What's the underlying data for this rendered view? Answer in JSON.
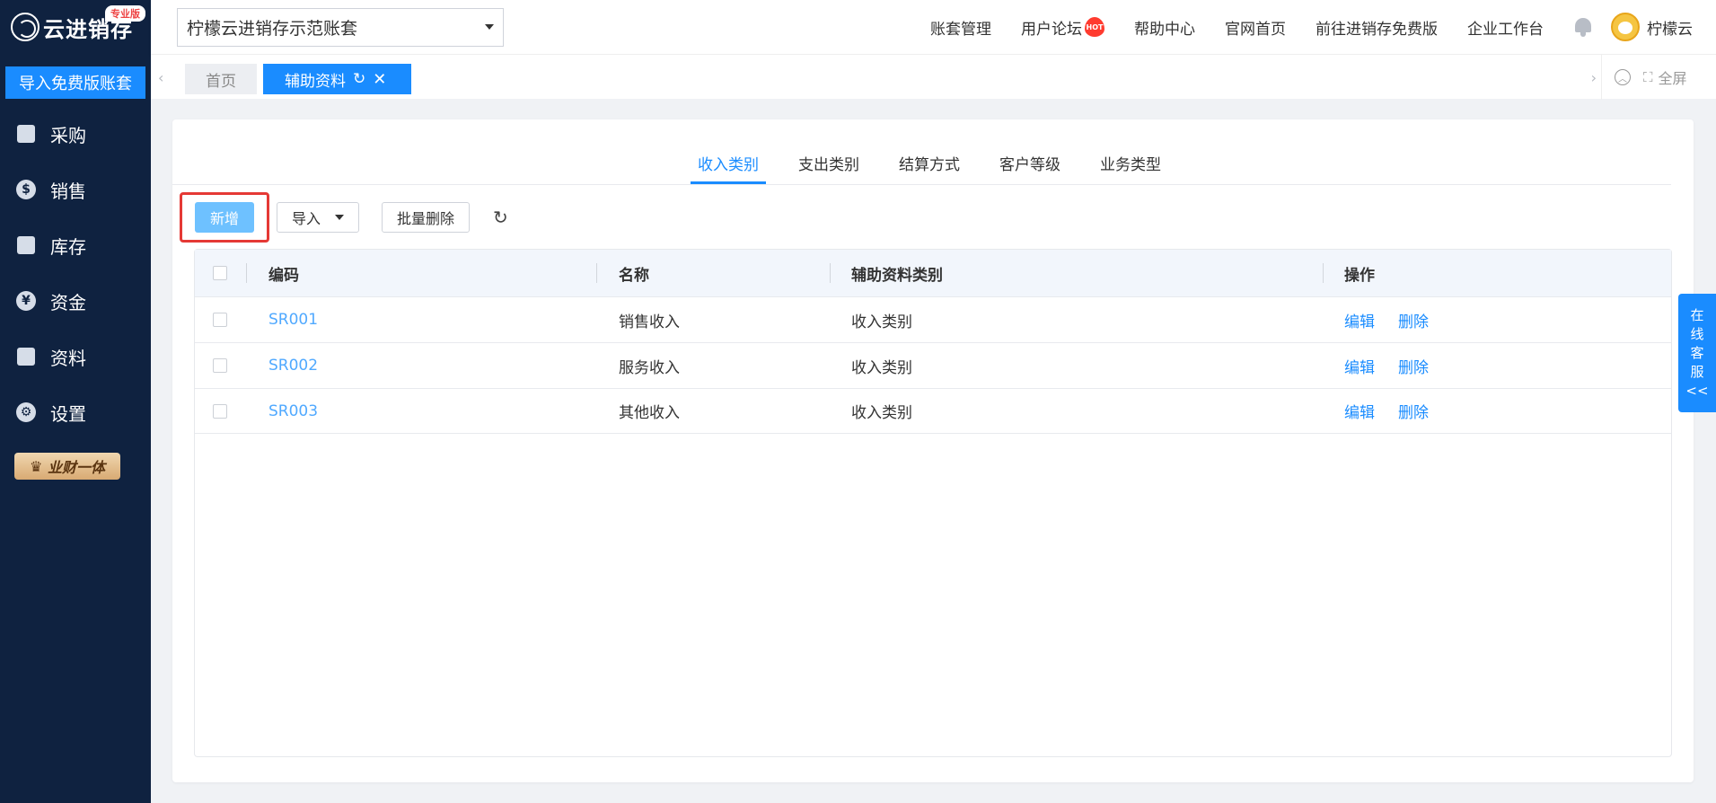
{
  "sidebar": {
    "logo_text": "云进销存",
    "pro_badge": "专业版",
    "import_button": "导入免费版账套",
    "items": [
      {
        "label": "采购",
        "icon": "shopping-bag-icon"
      },
      {
        "label": "销售",
        "icon": "sales-tag-icon"
      },
      {
        "label": "库存",
        "icon": "warehouse-icon"
      },
      {
        "label": "资金",
        "icon": "yen-coin-icon"
      },
      {
        "label": "资料",
        "icon": "document-icon"
      },
      {
        "label": "设置",
        "icon": "gear-icon"
      }
    ],
    "vip_badge": "业财一体"
  },
  "header": {
    "account_name": "柠檬云进销存示范账套",
    "links": [
      "账套管理",
      "用户论坛",
      "帮助中心",
      "官网首页",
      "前往进销存免费版",
      "企业工作台"
    ],
    "hot_label": "HOT",
    "user_name": "柠檬云"
  },
  "tabbar": {
    "home_tab": "首页",
    "active_tab": "辅助资料",
    "fullscreen_label": "全屏"
  },
  "sub_tabs": [
    "收入类别",
    "支出类别",
    "结算方式",
    "客户等级",
    "业务类型"
  ],
  "active_sub_tab": 0,
  "toolbar": {
    "add_label": "新增",
    "import_label": "导入",
    "batch_delete_label": "批量删除"
  },
  "table": {
    "headers": [
      "编码",
      "名称",
      "辅助资料类别",
      "操作"
    ],
    "rows": [
      {
        "code": "SR001",
        "name": "销售收入",
        "category": "收入类别"
      },
      {
        "code": "SR002",
        "name": "服务收入",
        "category": "收入类别"
      },
      {
        "code": "SR003",
        "name": "其他收入",
        "category": "收入类别"
      }
    ],
    "edit_label": "编辑",
    "delete_label": "删除"
  },
  "float_service": [
    "在",
    "线",
    "客",
    "服",
    "<<"
  ],
  "colors": {
    "sidebar_bg": "#0f2240",
    "accent": "#1a8cff",
    "highlight": "#e53935"
  }
}
